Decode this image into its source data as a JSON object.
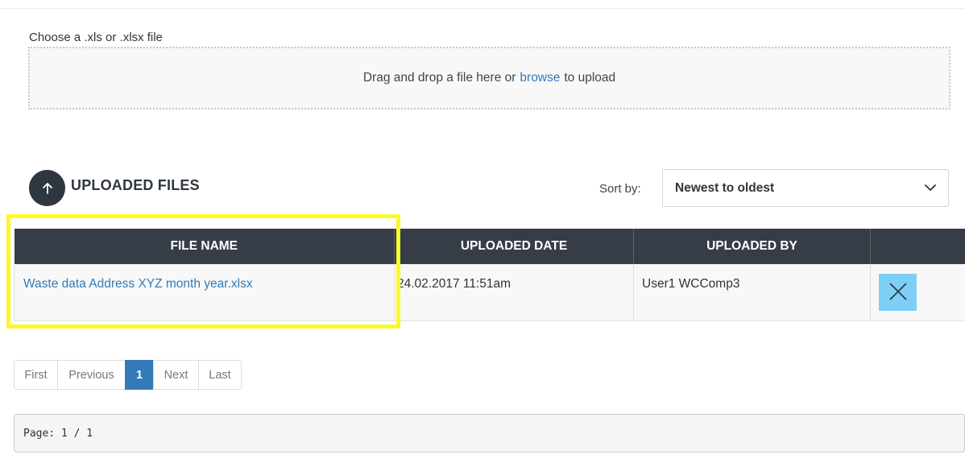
{
  "upload": {
    "label": "Choose a .xls or .xlsx file",
    "drop_before": "Drag and drop a file here or",
    "browse_link": "browse",
    "drop_after": "to upload"
  },
  "files_section": {
    "icon": "arrow-up-icon",
    "title": "UPLOADED FILES",
    "sort_label": "Sort by:",
    "sort_selected": "Newest to oldest"
  },
  "table": {
    "headers": [
      "FILE NAME",
      "UPLOADED DATE",
      "UPLOADED BY",
      ""
    ],
    "rows": [
      {
        "file_name": "Waste data Address XYZ month year.xlsx",
        "uploaded_date": "24.02.2017 11:51am",
        "uploaded_by": "User1 WCComp3",
        "action_icon": "close-icon"
      }
    ]
  },
  "pagination": {
    "first": "First",
    "previous": "Previous",
    "current": "1",
    "next": "Next",
    "last": "Last"
  },
  "page_info": "Page: 1 / 1",
  "colors": {
    "header_bg": "#363d47",
    "link": "#337ab7",
    "delete_button": "#7ecff5",
    "highlight": "#fbf82c"
  }
}
